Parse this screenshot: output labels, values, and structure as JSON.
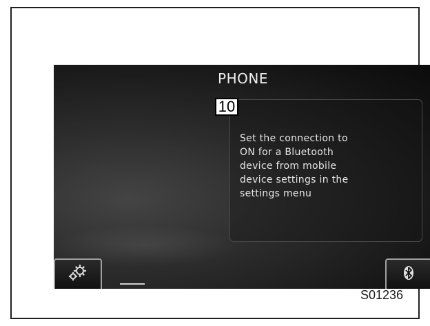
{
  "screen": {
    "title": "PHONE",
    "message": "Set the connection to\nON for a Bluetooth\ndevice from mobile\ndevice settings in the\nsettings menu",
    "buttons": {
      "settings_icon": "gear-cluster-icon",
      "bluetooth_icon": "bluetooth-icon"
    }
  },
  "callout": {
    "number": "10"
  },
  "figure": {
    "code": "S01236"
  },
  "colors": {
    "screen_background": "#141414",
    "screen_text": "#e6e6e6",
    "button_border": "#a0a0a0",
    "frame_border": "#1f1f1f"
  }
}
